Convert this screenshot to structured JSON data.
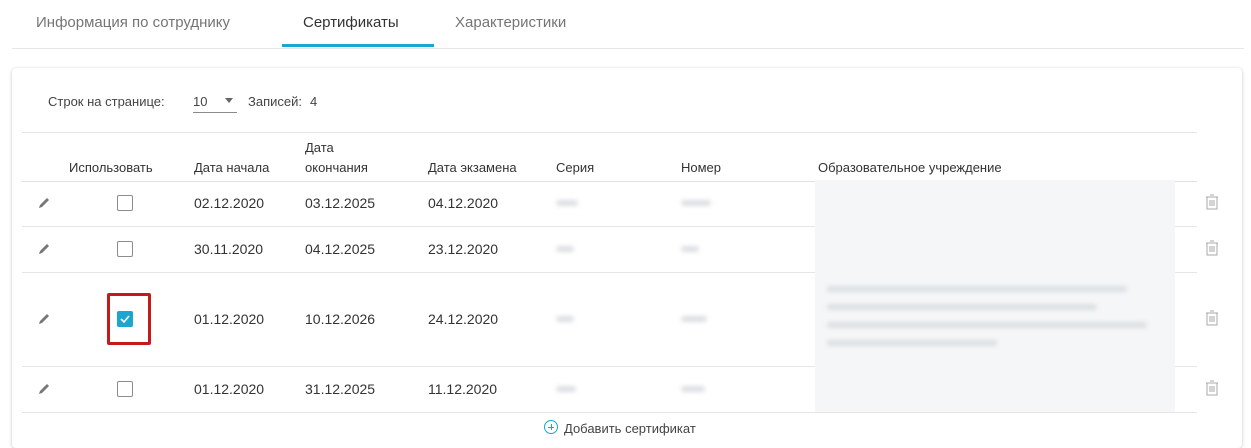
{
  "tabs": [
    {
      "label": "Информация по сотруднику",
      "active": false
    },
    {
      "label": "Сертификаты",
      "active": true
    },
    {
      "label": "Характеристики",
      "active": false
    }
  ],
  "pager": {
    "rows_per_page_label": "Строк на странице:",
    "rows_per_page_value": "10",
    "records_label": "Записей:",
    "records_count": "4"
  },
  "table": {
    "headers": {
      "use": "Использовать",
      "start_date": "Дата начала",
      "end_date_line1": "Дата",
      "end_date_line2": "окончания",
      "exam_date": "Дата экзамена",
      "series": "Серия",
      "number": "Номер",
      "institution": "Образовательное учреждение"
    },
    "rows": [
      {
        "use": false,
        "start_date": "02.12.2020",
        "end_date": "03.12.2025",
        "exam_date": "04.12.2020"
      },
      {
        "use": false,
        "start_date": "30.11.2020",
        "end_date": "04.12.2025",
        "exam_date": "23.12.2020"
      },
      {
        "use": true,
        "start_date": "01.12.2020",
        "end_date": "10.12.2026",
        "exam_date": "24.12.2020"
      },
      {
        "use": false,
        "start_date": "01.12.2020",
        "end_date": "31.12.2025",
        "exam_date": "11.12.2020"
      }
    ]
  },
  "add_button": {
    "label": "Добавить сертификат"
  },
  "colors": {
    "accent": "#1ba5d1",
    "highlight": "#c41a1a"
  },
  "icons": {
    "edit": "pencil-icon",
    "delete": "trash-icon",
    "add": "plus-circle-icon",
    "dropdown": "caret-down-icon"
  }
}
